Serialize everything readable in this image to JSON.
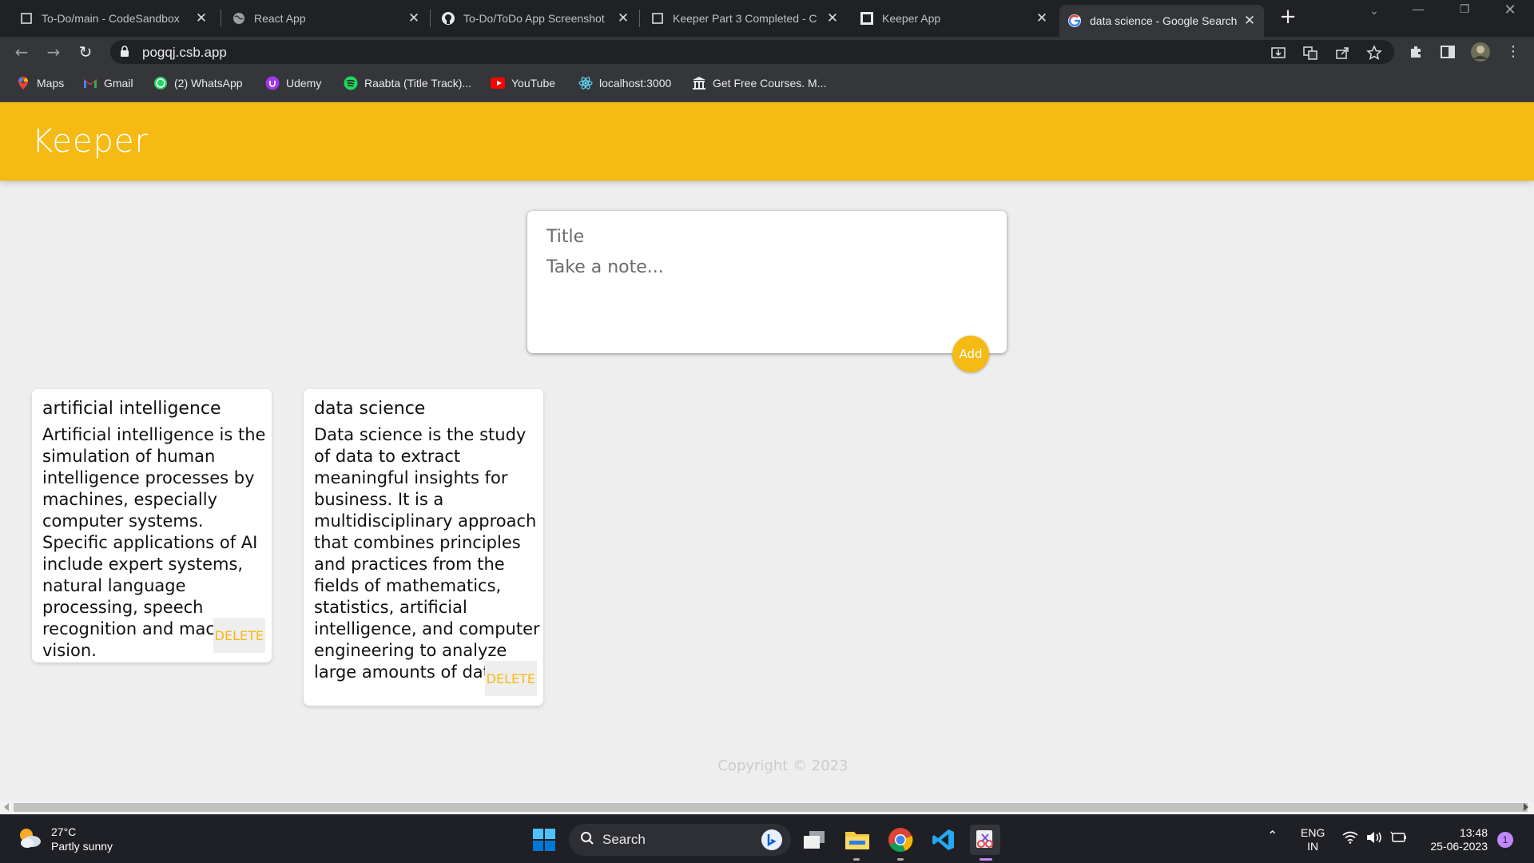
{
  "browser": {
    "tabs": [
      {
        "label": "To-Do/main - CodeSandbox",
        "icon": "page-icon"
      },
      {
        "label": "React App",
        "icon": "globe-icon"
      },
      {
        "label": "To-Do/ToDo App Screenshot",
        "icon": "github-icon"
      },
      {
        "label": "Keeper Part 3 Completed - C",
        "icon": "page-icon"
      },
      {
        "label": "Keeper App",
        "icon": "codesandbox-icon"
      },
      {
        "label": "data science - Google Search",
        "icon": "google-icon"
      }
    ],
    "url": "pogqj.csb.app",
    "bookmarks": [
      {
        "label": "Maps",
        "icon": "maps-icon"
      },
      {
        "label": "Gmail",
        "icon": "gmail-icon"
      },
      {
        "label": "(2) WhatsApp",
        "icon": "whatsapp-icon"
      },
      {
        "label": "Udemy",
        "icon": "udemy-icon"
      },
      {
        "label": "Raabta (Title Track)...",
        "icon": "spotify-icon"
      },
      {
        "label": "YouTube",
        "icon": "youtube-icon"
      },
      {
        "label": "localhost:3000",
        "icon": "react-icon"
      },
      {
        "label": "Get Free Courses. M...",
        "icon": "institution-icon"
      }
    ]
  },
  "app": {
    "title": "Keeper",
    "create": {
      "title_placeholder": "Title",
      "content_placeholder": "Take a note...",
      "add_label": "Add"
    },
    "notes": [
      {
        "title": "artificial intelligence",
        "content": "Artificial intelligence is the simulation of human intelligence processes by machines, especially computer systems. Specific applications of AI include expert systems, natural language processing, speech recognition and machine vision.",
        "delete_label": "DELETE"
      },
      {
        "title": "data science",
        "content": "Data science is the study of data to extract meaningful insights for business. It is a multidisciplinary approach that combines principles and practices from the fields of mathematics, statistics, artificial intelligence, and computer engineering to analyze large amounts of data.",
        "delete_label": "DELETE"
      }
    ],
    "footer": "Copyright © 2023"
  },
  "taskbar": {
    "weather_temp": "27°C",
    "weather_desc": "Partly sunny",
    "search_label": "Search",
    "lang_top": "ENG",
    "lang_bottom": "IN",
    "time": "13:48",
    "date": "25-06-2023",
    "notification_count": "1"
  },
  "colors": {
    "accent": "#f5ba13",
    "background": "#eeeeee",
    "chrome_dark": "#202124",
    "chrome_toolbar": "#35363a"
  }
}
